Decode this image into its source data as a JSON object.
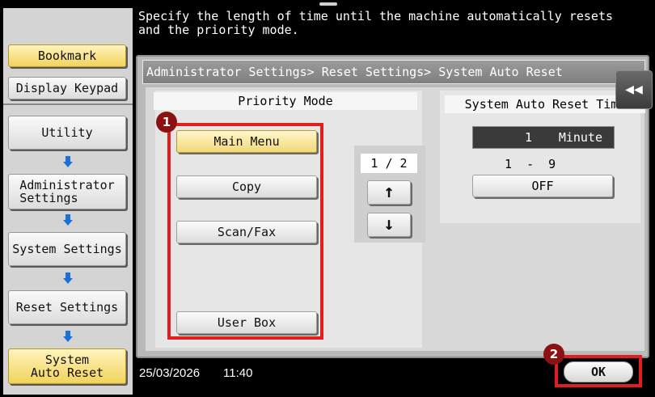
{
  "message": "Specify the length of time until the machine automatically resets\nand the priority mode.",
  "sidebar": {
    "bookmark_label": "Bookmark",
    "display_keypad_label": "Display Keypad",
    "nav": {
      "utility": "Utility",
      "administrator_settings": [
        "Administrator",
        "Settings"
      ],
      "system_settings": "System Settings",
      "reset_settings": "Reset Settings",
      "system_auto_reset": [
        "System",
        "Auto Reset"
      ]
    }
  },
  "breadcrumb": "Administrator Settings> Reset Settings> System Auto Reset",
  "priority_mode": {
    "title": "Priority Mode",
    "options": [
      "Main Menu",
      "Copy",
      "Scan/Fax",
      "User Box"
    ],
    "selected": "Main Menu",
    "page_indicator": "1 / 2",
    "up_arrow": "↑",
    "down_arrow": "↓"
  },
  "auto_reset_time": {
    "title": "System Auto Reset Time",
    "value": "1",
    "unit": "Minute",
    "range": "1  -  9",
    "off_label": "OFF"
  },
  "collapse_glyph": "◀◀",
  "status": {
    "date": "25/03/2026",
    "time": "11:40"
  },
  "ok_label": "OK",
  "annotations": {
    "badge_1": "1",
    "badge_2": "2"
  },
  "colors": {
    "highlight": "#e21d1d",
    "badge": "#8b1212",
    "selected_button": "#f3d978",
    "arrow": "#1a6fdb"
  }
}
